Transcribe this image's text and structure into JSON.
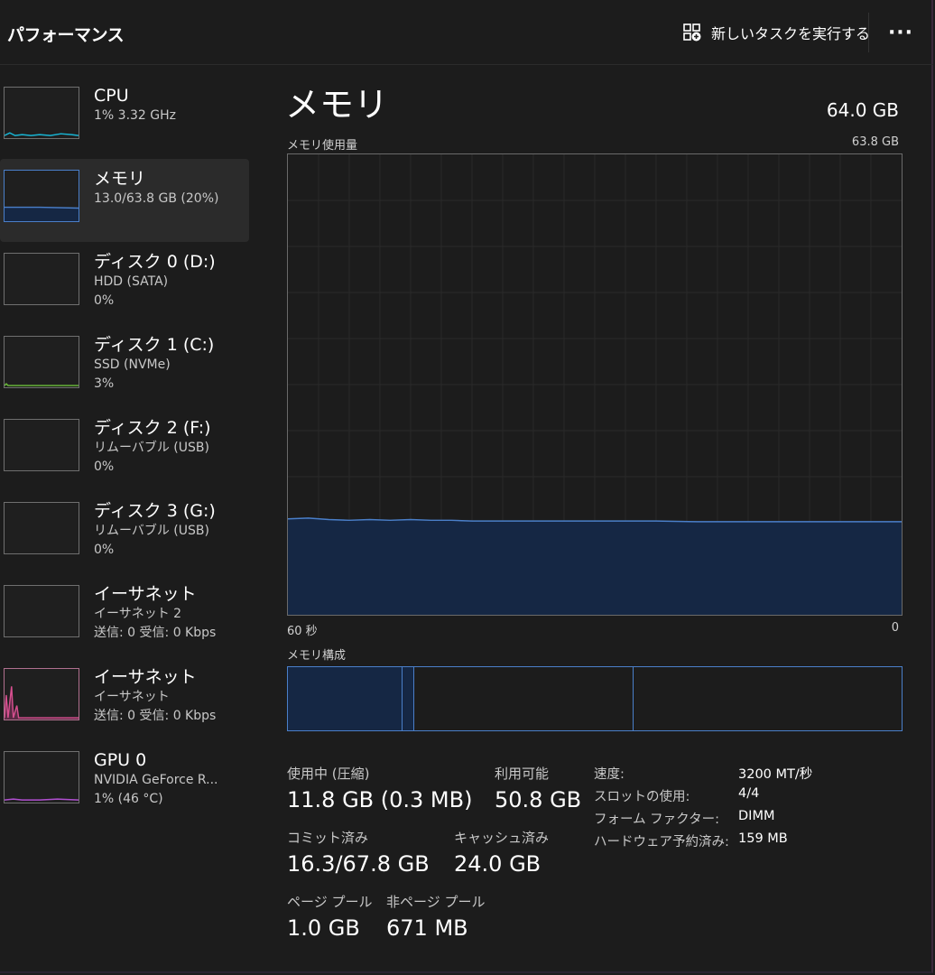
{
  "header": {
    "title": "パフォーマンス",
    "run_task_label": "新しいタスクを実行する",
    "more_label": "···"
  },
  "sidebar": {
    "items": [
      {
        "title": "CPU",
        "lines": [
          "1%  3.32 GHz"
        ],
        "color": "#17b5d4",
        "active": false
      },
      {
        "title": "メモリ",
        "lines": [
          "13.0/63.8 GB (20%)"
        ],
        "color": "#4a7fc9",
        "active": true
      },
      {
        "title": "ディスク 0 (D:)",
        "lines": [
          "HDD (SATA)",
          "0%"
        ],
        "color": "#6cbf3a",
        "active": false
      },
      {
        "title": "ディスク 1 (C:)",
        "lines": [
          "SSD (NVMe)",
          "3%"
        ],
        "color": "#6cbf3a",
        "active": false
      },
      {
        "title": "ディスク 2 (F:)",
        "lines": [
          "リムーバブル (USB)",
          "0%"
        ],
        "color": "#6cbf3a",
        "active": false
      },
      {
        "title": "ディスク 3 (G:)",
        "lines": [
          "リムーバブル (USB)",
          "0%"
        ],
        "color": "#6cbf3a",
        "active": false
      },
      {
        "title": "イーサネット",
        "lines": [
          "イーサネット 2",
          "送信: 0 受信: 0 Kbps"
        ],
        "color": "#d64f8f",
        "active": false
      },
      {
        "title": "イーサネット",
        "lines": [
          "イーサネット",
          "送信: 0 受信: 0 Kbps"
        ],
        "color": "#d64f8f",
        "active": false
      },
      {
        "title": "GPU 0",
        "lines": [
          "NVIDIA GeForce R...",
          "1%  (46 °C)"
        ],
        "color": "#b04fd0",
        "active": false
      }
    ]
  },
  "main": {
    "title": "メモリ",
    "total": "64.0 GB",
    "graph_label": "メモリ使用量",
    "graph_max": "63.8 GB",
    "time_left": "60 秒",
    "time_right": "0",
    "composition_label": "メモリ構成",
    "stats": {
      "in_use_label": "使用中 (圧縮)",
      "in_use_value": "11.8 GB (0.3 MB)",
      "available_label": "利用可能",
      "available_value": "50.8 GB",
      "committed_label": "コミット済み",
      "committed_value": "16.3/67.8 GB",
      "cached_label": "キャッシュ済み",
      "cached_value": "24.0 GB",
      "paged_label": "ページ プール",
      "paged_value": "1.0 GB",
      "nonpaged_label": "非ページ プール",
      "nonpaged_value": "671 MB"
    },
    "specs": [
      {
        "key": "速度:",
        "value": "3200 MT/秒"
      },
      {
        "key": "スロットの使用:",
        "value": "4/4"
      },
      {
        "key": "フォーム ファクター:",
        "value": "DIMM"
      },
      {
        "key": "ハードウェア予約済み:",
        "value": "159 MB"
      }
    ]
  },
  "chart_data": {
    "type": "area",
    "ylim": [
      0,
      63.8
    ],
    "x": [
      60,
      58,
      56,
      54,
      52,
      50,
      48,
      46,
      44,
      42,
      40,
      36,
      30,
      24,
      20,
      16,
      12,
      8,
      4,
      0
    ],
    "values": [
      13.3,
      13.4,
      13.2,
      13.1,
      13.2,
      13.1,
      13.2,
      13.1,
      13.1,
      13.0,
      13.0,
      13.0,
      13.0,
      13.0,
      12.9,
      12.9,
      12.9,
      12.9,
      12.9,
      12.9
    ]
  },
  "colors": {
    "accent": "#4a7fc9",
    "fill": "#152744",
    "grid": "#2a2a2a"
  }
}
